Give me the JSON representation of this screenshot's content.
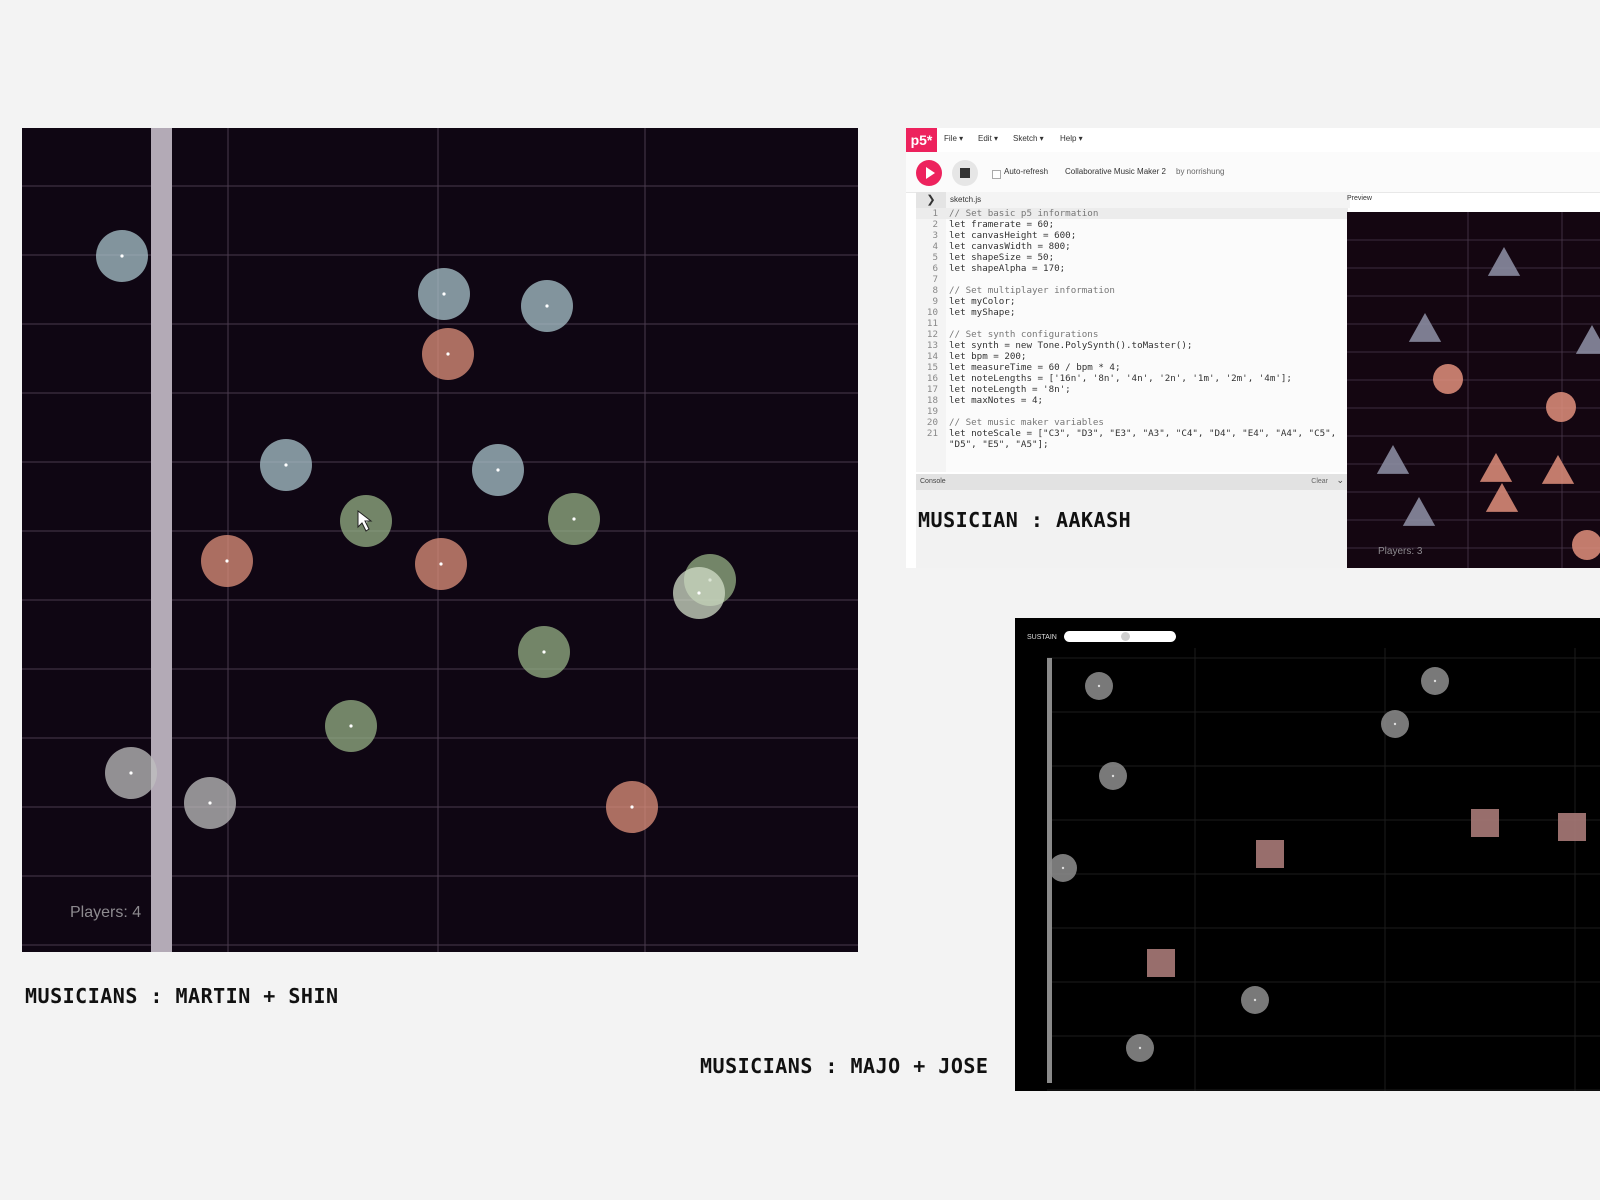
{
  "panel_left": {
    "players": "Players: 4",
    "caption": "MUSICIANS : MARTIN + SHIN"
  },
  "editor": {
    "logo": "p5*",
    "menus": [
      "File ▾",
      "Edit ▾",
      "Sketch ▾",
      "Help ▾"
    ],
    "auto_refresh_label": "Auto-refresh",
    "sketch_title": "Collaborative Music Maker 2",
    "author": "by norrishung",
    "file_tab": "sketch.js",
    "preview_label": "Preview",
    "console_label": "Console",
    "clear_label": "Clear",
    "code_lines": [
      {
        "n": "1",
        "t": "// Set basic p5 information"
      },
      {
        "n": "2",
        "t": "let framerate = 60;"
      },
      {
        "n": "3",
        "t": "let canvasHeight = 600;"
      },
      {
        "n": "4",
        "t": "let canvasWidth = 800;"
      },
      {
        "n": "5",
        "t": "let shapeSize = 50;"
      },
      {
        "n": "6",
        "t": "let shapeAlpha = 170;"
      },
      {
        "n": "7",
        "t": ""
      },
      {
        "n": "8",
        "t": "// Set multiplayer information"
      },
      {
        "n": "9",
        "t": "let myColor;"
      },
      {
        "n": "10",
        "t": "let myShape;"
      },
      {
        "n": "11",
        "t": ""
      },
      {
        "n": "12",
        "t": "// Set synth configurations"
      },
      {
        "n": "13",
        "t": "let synth = new Tone.PolySynth().toMaster();"
      },
      {
        "n": "14",
        "t": "let bpm = 200;"
      },
      {
        "n": "15",
        "t": "let measureTime = 60 / bpm * 4;"
      },
      {
        "n": "16",
        "t": "let noteLengths = ['16n', '8n', '4n', '2n', '1m', '2m', '4m'];"
      },
      {
        "n": "17",
        "t": "let noteLength = '8n';"
      },
      {
        "n": "18",
        "t": "let maxNotes = 4;"
      },
      {
        "n": "19",
        "t": ""
      },
      {
        "n": "20",
        "t": "// Set music maker variables"
      },
      {
        "n": "21",
        "t": "let noteScale = [\"C3\", \"D3\", \"E3\", \"A3\", \"C4\", \"D4\", \"E4\", \"A4\", \"C5\","
      },
      {
        "n": "",
        "t": "\"D5\", \"E5\", \"A5\"];"
      }
    ],
    "preview_players": "Players: 3",
    "caption": "MUSICIAN : AAKASH"
  },
  "panel_br": {
    "sustain_label": "SUSTAIN",
    "caption": "MUSICIANS : MAJO + JOSE"
  },
  "colors": {
    "p5_pink": "#ed225d",
    "blue_note": "#aac4cc",
    "salmon_note": "#e0917c",
    "green_note": "#a9c39a",
    "grey_note": "#bfbfbf",
    "square_note": "#a97a78"
  }
}
